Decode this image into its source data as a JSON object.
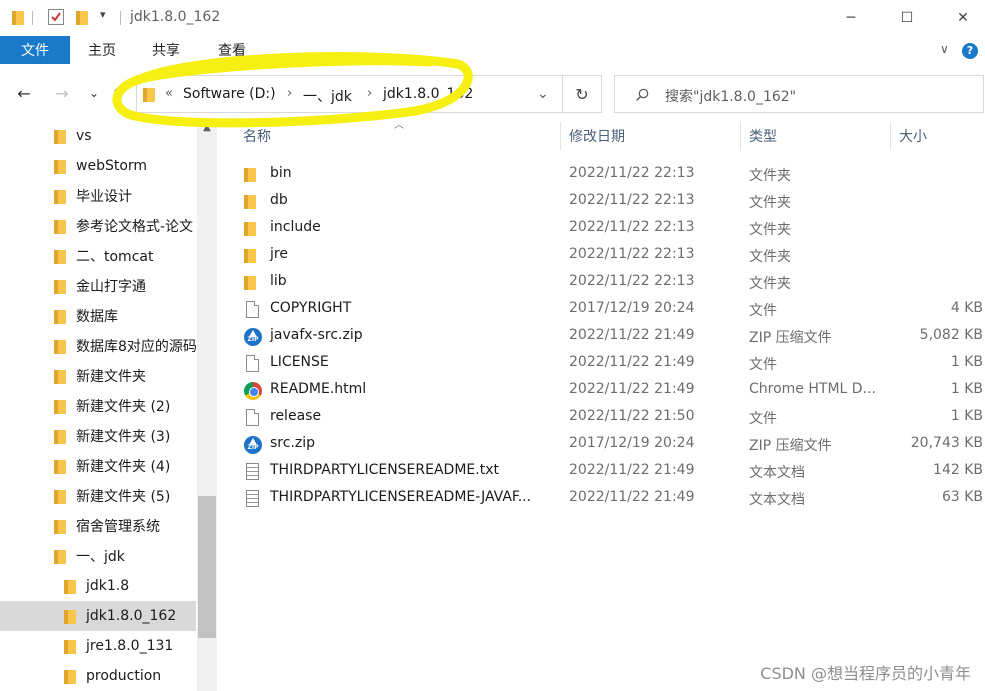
{
  "window": {
    "title": "jdk1.8.0_162",
    "minimize_glyph": "─",
    "maximize_glyph": "☐",
    "close_glyph": "✕"
  },
  "ribbon": {
    "file_tab": "文件",
    "tabs": [
      "主页",
      "共享",
      "查看"
    ],
    "expand_glyph": "∨",
    "help_glyph": "?"
  },
  "navigation": {
    "back_glyph": "←",
    "forward_glyph": "→",
    "recent_glyph": "⌄",
    "up_glyph": "↑",
    "breadcrumb_overflow": "«",
    "breadcrumb": [
      "Software (D:)",
      "一、jdk",
      "jdk1.8.0_162"
    ],
    "dropdown_glyph": "⌄",
    "refresh_glyph": "↻",
    "search_placeholder": "搜索\"jdk1.8.0_162\"",
    "highlight_color": "#f5ef12"
  },
  "sidebar": {
    "items": [
      {
        "label": "vs",
        "indent": 0
      },
      {
        "label": "webStorm",
        "indent": 0
      },
      {
        "label": "毕业设计",
        "indent": 0
      },
      {
        "label": "参考论文格式-论文",
        "indent": 0
      },
      {
        "label": "二、tomcat",
        "indent": 0
      },
      {
        "label": "金山打字通",
        "indent": 0
      },
      {
        "label": "数据库",
        "indent": 0
      },
      {
        "label": "数据库8对应的源码",
        "indent": 0
      },
      {
        "label": "新建文件夹",
        "indent": 0
      },
      {
        "label": "新建文件夹 (2)",
        "indent": 0
      },
      {
        "label": "新建文件夹 (3)",
        "indent": 0
      },
      {
        "label": "新建文件夹 (4)",
        "indent": 0
      },
      {
        "label": "新建文件夹 (5)",
        "indent": 0
      },
      {
        "label": "宿舍管理系统",
        "indent": 0
      },
      {
        "label": "一、jdk",
        "indent": 0
      },
      {
        "label": "jdk1.8",
        "indent": 1
      },
      {
        "label": "jdk1.8.0_162",
        "indent": 1,
        "selected": true
      },
      {
        "label": "jre1.8.0_131",
        "indent": 1
      },
      {
        "label": "production",
        "indent": 1
      }
    ]
  },
  "columns": {
    "name": "名称",
    "date": "修改日期",
    "type": "类型",
    "size": "大小"
  },
  "files": [
    {
      "name": "bin",
      "date": "2022/11/22 22:13",
      "type": "文件夹",
      "size": "",
      "icon": "folder-icon"
    },
    {
      "name": "db",
      "date": "2022/11/22 22:13",
      "type": "文件夹",
      "size": "",
      "icon": "folder-icon"
    },
    {
      "name": "include",
      "date": "2022/11/22 22:13",
      "type": "文件夹",
      "size": "",
      "icon": "folder-icon"
    },
    {
      "name": "jre",
      "date": "2022/11/22 22:13",
      "type": "文件夹",
      "size": "",
      "icon": "folder-icon"
    },
    {
      "name": "lib",
      "date": "2022/11/22 22:13",
      "type": "文件夹",
      "size": "",
      "icon": "folder-icon"
    },
    {
      "name": "COPYRIGHT",
      "date": "2017/12/19 20:24",
      "type": "文件",
      "size": "4 KB",
      "icon": "file-icon"
    },
    {
      "name": "javafx-src.zip",
      "date": "2022/11/22 21:49",
      "type": "ZIP 压缩文件",
      "size": "5,082 KB",
      "icon": "zip-icon"
    },
    {
      "name": "LICENSE",
      "date": "2022/11/22 21:49",
      "type": "文件",
      "size": "1 KB",
      "icon": "file-icon"
    },
    {
      "name": "README.html",
      "date": "2022/11/22 21:49",
      "type": "Chrome HTML D...",
      "size": "1 KB",
      "icon": "chrome-icon"
    },
    {
      "name": "release",
      "date": "2022/11/22 21:50",
      "type": "文件",
      "size": "1 KB",
      "icon": "file-icon"
    },
    {
      "name": "src.zip",
      "date": "2017/12/19 20:24",
      "type": "ZIP 压缩文件",
      "size": "20,743 KB",
      "icon": "zip-icon"
    },
    {
      "name": "THIRDPARTYLICENSEREADME.txt",
      "date": "2022/11/22 21:49",
      "type": "文本文档",
      "size": "142 KB",
      "icon": "text-file-icon"
    },
    {
      "name": "THIRDPARTYLICENSEREADME-JAVAF...",
      "date": "2022/11/22 21:49",
      "type": "文本文档",
      "size": "63 KB",
      "icon": "text-file-icon"
    }
  ],
  "zip_icon_label": "ZIP",
  "watermark": "CSDN @想当程序员的小青年"
}
